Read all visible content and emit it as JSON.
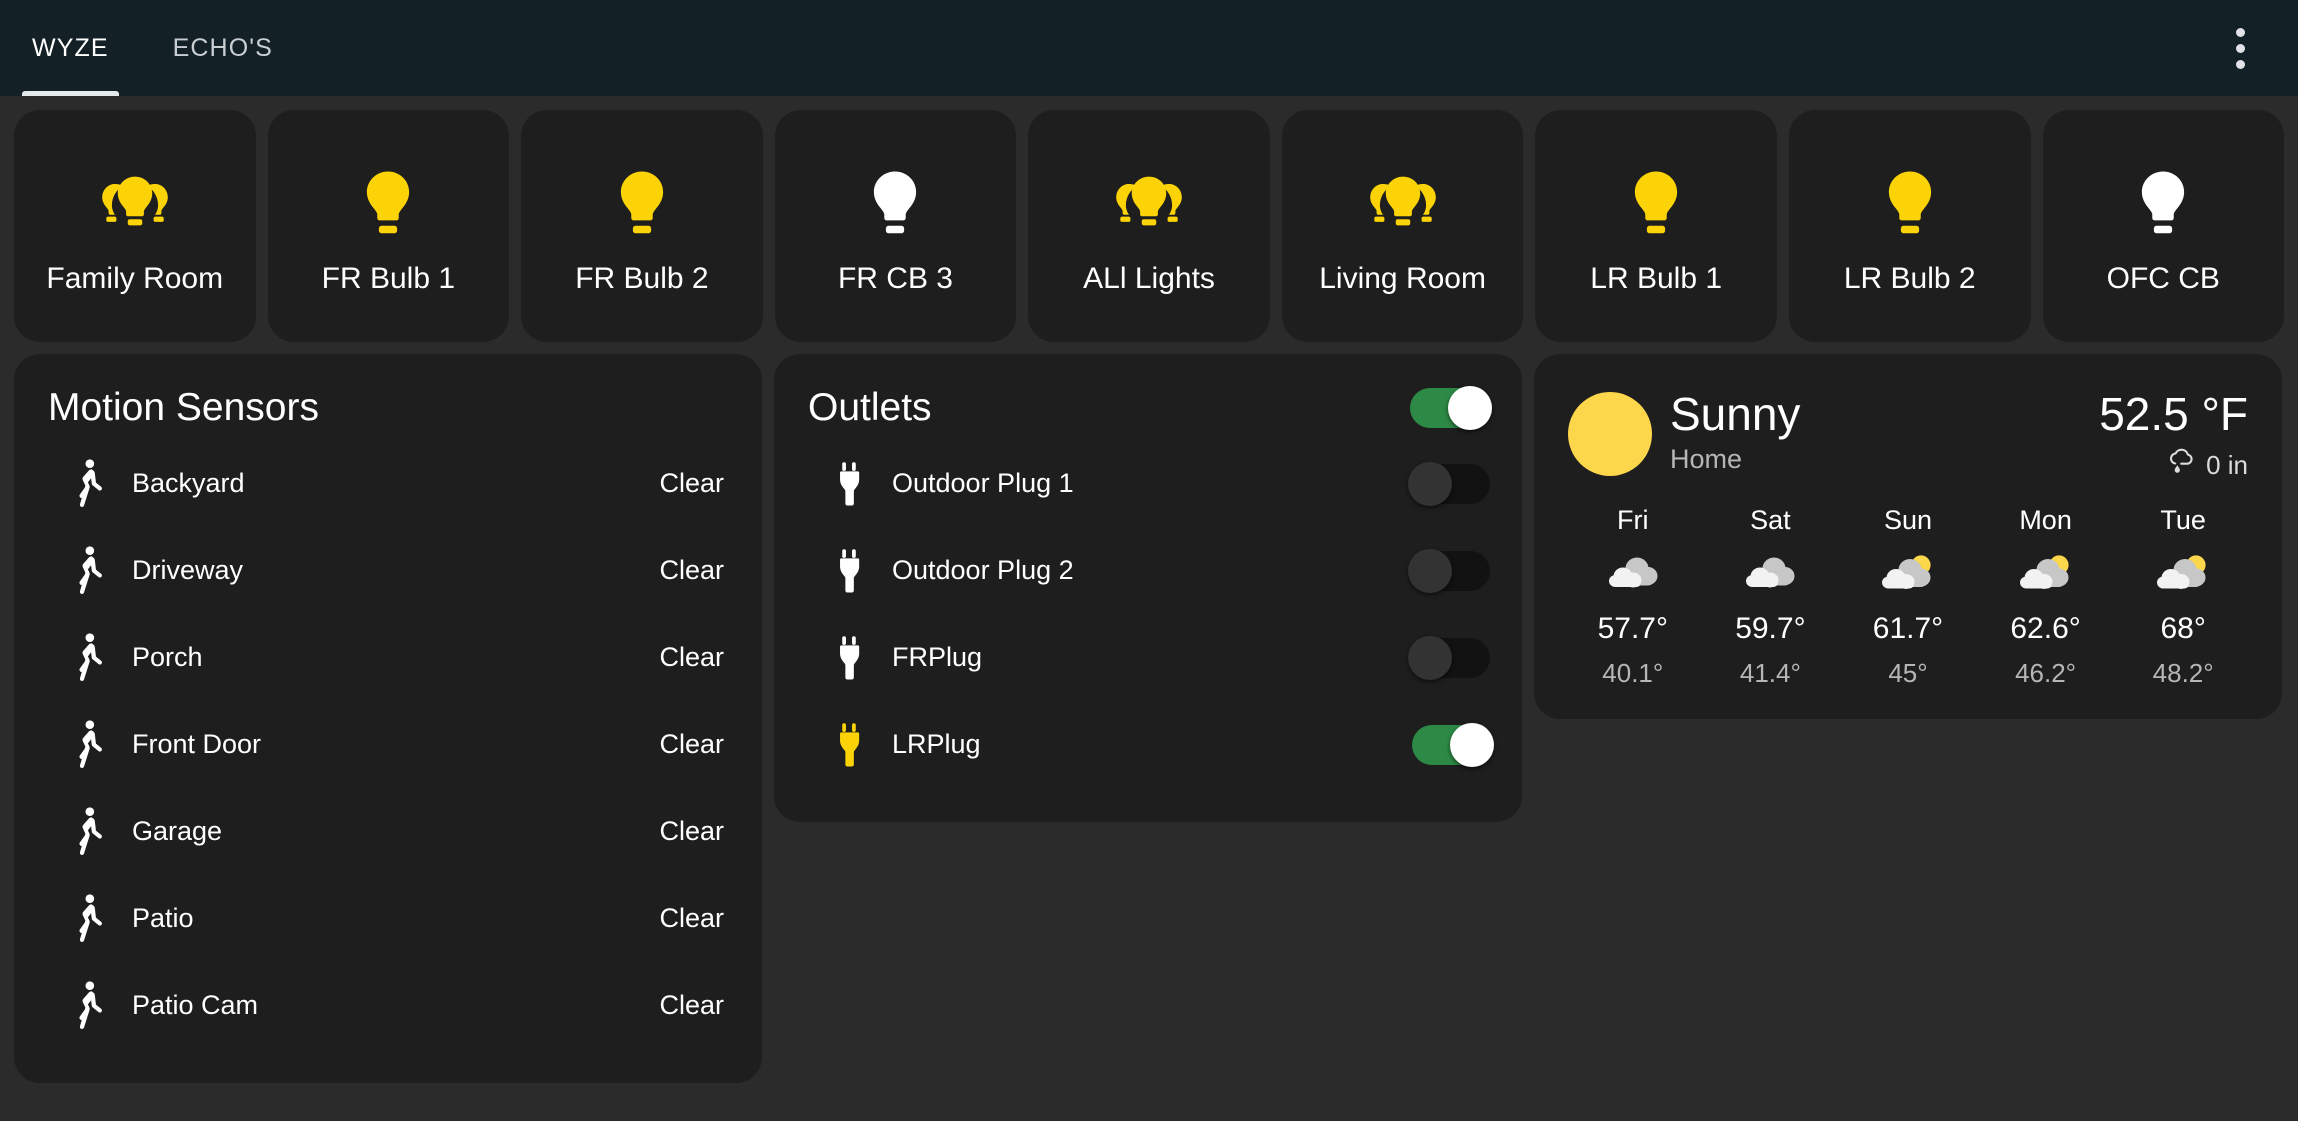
{
  "header": {
    "tabs": [
      {
        "label": "WYZE",
        "active": true
      },
      {
        "label": "ECHO'S",
        "active": false
      }
    ],
    "overflow_icon": "more-vert-icon"
  },
  "tiles": [
    {
      "label": "Family Room",
      "icon": "light-group-icon",
      "state": "on",
      "color": "#fcd307"
    },
    {
      "label": "FR Bulb 1",
      "icon": "lightbulb-icon",
      "state": "on",
      "color": "#fcd307"
    },
    {
      "label": "FR Bulb 2",
      "icon": "lightbulb-icon",
      "state": "on",
      "color": "#fcd307"
    },
    {
      "label": "FR CB 3",
      "icon": "lightbulb-icon",
      "state": "off",
      "color": "#ffffff"
    },
    {
      "label": "ALl Lights",
      "icon": "light-group-icon",
      "state": "on",
      "color": "#fcd307"
    },
    {
      "label": "Living Room",
      "icon": "light-group-icon",
      "state": "on",
      "color": "#fcd307"
    },
    {
      "label": "LR Bulb 1",
      "icon": "lightbulb-icon",
      "state": "on",
      "color": "#fcd307"
    },
    {
      "label": "LR Bulb 2",
      "icon": "lightbulb-icon",
      "state": "on",
      "color": "#fcd307"
    },
    {
      "label": "OFC CB",
      "icon": "lightbulb-icon",
      "state": "off",
      "color": "#ffffff"
    }
  ],
  "motion_sensors": {
    "title": "Motion Sensors",
    "icon": "walking-person-icon",
    "rows": [
      {
        "name": "Backyard",
        "status": "Clear"
      },
      {
        "name": "Driveway",
        "status": "Clear"
      },
      {
        "name": "Porch",
        "status": "Clear"
      },
      {
        "name": "Front Door",
        "status": "Clear"
      },
      {
        "name": "Garage",
        "status": "Clear"
      },
      {
        "name": "Patio",
        "status": "Clear"
      },
      {
        "name": "Patio Cam",
        "status": "Clear"
      }
    ]
  },
  "outlets": {
    "title": "Outlets",
    "master_toggle": "on",
    "icon": "power-plug-icon",
    "rows": [
      {
        "name": "Outdoor Plug 1",
        "toggle": "off",
        "icon_color": "#ffffff"
      },
      {
        "name": "Outdoor Plug 2",
        "toggle": "off",
        "icon_color": "#ffffff"
      },
      {
        "name": "FRPlug",
        "toggle": "off",
        "icon_color": "#ffffff"
      },
      {
        "name": "LRPlug",
        "toggle": "on",
        "icon_color": "#fcd307"
      }
    ]
  },
  "weather": {
    "condition": "Sunny",
    "location": "Home",
    "current_temp": "52.5 °F",
    "precip_icon": "rain-cloud-icon",
    "precipitation": "0 in",
    "sun_icon": "sun-icon",
    "forecast": [
      {
        "day": "Fri",
        "icon": "cloudy-icon",
        "high": "57.7°",
        "low": "40.1°"
      },
      {
        "day": "Sat",
        "icon": "cloudy-icon",
        "high": "59.7°",
        "low": "41.4°"
      },
      {
        "day": "Sun",
        "icon": "partly-cloudy-icon",
        "high": "61.7°",
        "low": "45°"
      },
      {
        "day": "Mon",
        "icon": "partly-cloudy-icon",
        "high": "62.6°",
        "low": "46.2°"
      },
      {
        "day": "Tue",
        "icon": "partly-cloudy-icon",
        "high": "68°",
        "low": "48.2°"
      }
    ]
  },
  "colors": {
    "accent_on": "#fcd307",
    "accent_off": "#ffffff",
    "toggle_on": "#2d8a46",
    "card_bg": "#1e1e1e",
    "page_bg": "#2b2b2b",
    "appbar_bg": "#132026"
  }
}
